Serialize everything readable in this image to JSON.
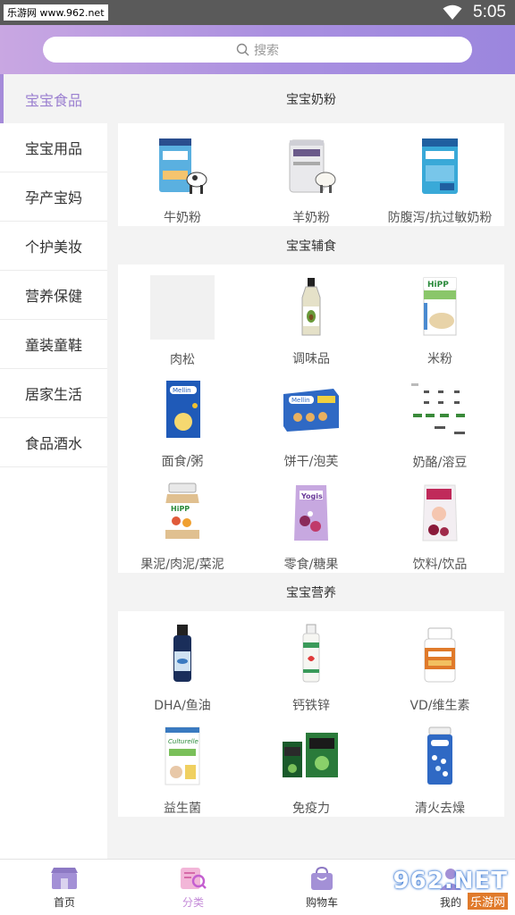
{
  "status_bar": {
    "watermark": "乐游网 www.962.net",
    "time": "5:05"
  },
  "search": {
    "placeholder": "搜索"
  },
  "sidebar": {
    "items": [
      {
        "label": "宝宝食品"
      },
      {
        "label": "宝宝用品"
      },
      {
        "label": "孕产宝妈"
      },
      {
        "label": "个护美妆"
      },
      {
        "label": "营养保健"
      },
      {
        "label": "童装童鞋"
      },
      {
        "label": "居家生活"
      },
      {
        "label": "食品酒水"
      }
    ]
  },
  "sections": [
    {
      "title": "宝宝奶粉",
      "items": [
        {
          "label": "牛奶粉",
          "icon": "cow-milk-powder-can"
        },
        {
          "label": "羊奶粉",
          "icon": "goat-milk-powder-can"
        },
        {
          "label": "防腹泻/抗过敏奶粉",
          "icon": "hypoallergenic-formula-can"
        }
      ]
    },
    {
      "title": "宝宝辅食",
      "items": [
        {
          "label": "肉松",
          "icon": "meat-floss-placeholder"
        },
        {
          "label": "调味品",
          "icon": "oil-bottle"
        },
        {
          "label": "米粉",
          "icon": "rice-cereal-box"
        },
        {
          "label": "面食/粥",
          "icon": "noodle-box"
        },
        {
          "label": "饼干/泡芙",
          "icon": "biscuit-box"
        },
        {
          "label": "奶酪/溶豆",
          "icon": "cheese-chart"
        },
        {
          "label": "果泥/肉泥/菜泥",
          "icon": "puree-jar"
        },
        {
          "label": "零食/糖果",
          "icon": "snack-pouch"
        },
        {
          "label": "饮料/饮品",
          "icon": "drink-pouch"
        }
      ]
    },
    {
      "title": "宝宝营养",
      "items": [
        {
          "label": "DHA/鱼油",
          "icon": "fish-oil-bottle"
        },
        {
          "label": "钙铁锌",
          "icon": "calcium-bottle"
        },
        {
          "label": "VD/维生素",
          "icon": "vitamin-bottle"
        },
        {
          "label": "益生菌",
          "icon": "probiotic-box"
        },
        {
          "label": "免疫力",
          "icon": "immunity-boxes"
        },
        {
          "label": "清火去燥",
          "icon": "cooling-tin"
        }
      ]
    }
  ],
  "tabbar": {
    "tabs": [
      {
        "label": "首页",
        "icon": "store-icon"
      },
      {
        "label": "分类",
        "icon": "category-search-icon"
      },
      {
        "label": "购物车",
        "icon": "shopping-bag-icon"
      },
      {
        "label": "我的",
        "icon": "user-icon"
      }
    ],
    "watermark": {
      "main": "962.NET",
      "sub": "乐游网"
    }
  },
  "colors": {
    "accent": "#a58bd9",
    "header_start": "#c9a7e2",
    "header_end": "#9b86de",
    "active_tab": "#c48ad8"
  }
}
